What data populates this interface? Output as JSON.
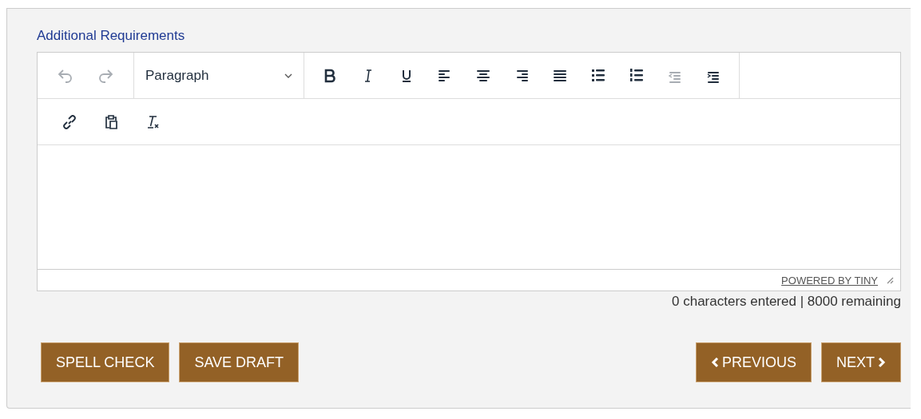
{
  "field": {
    "label": "Additional Requirements"
  },
  "toolbar": [
    {
      "groups": [
        {
          "items": [
            {
              "kind": "undo",
              "disabled": true
            },
            {
              "kind": "redo",
              "disabled": true
            }
          ]
        },
        {
          "items": [
            {
              "kind": "select",
              "value": "Paragraph",
              "disabled": false
            }
          ]
        },
        {
          "items": [
            {
              "kind": "bold",
              "disabled": false
            },
            {
              "kind": "italic",
              "disabled": false
            },
            {
              "kind": "underline",
              "disabled": false
            },
            {
              "kind": "align-left",
              "disabled": false
            },
            {
              "kind": "align-center",
              "disabled": false
            },
            {
              "kind": "align-right",
              "disabled": false
            },
            {
              "kind": "justify",
              "disabled": false
            },
            {
              "kind": "bullets",
              "disabled": false
            },
            {
              "kind": "numbers",
              "disabled": false
            },
            {
              "kind": "outdent",
              "disabled": true
            },
            {
              "kind": "indent",
              "disabled": false
            }
          ]
        }
      ]
    },
    {
      "groups": [
        {
          "items": [
            {
              "kind": "link",
              "disabled": false
            },
            {
              "kind": "paste",
              "disabled": false
            },
            {
              "kind": "clear-format",
              "disabled": false
            }
          ]
        }
      ]
    }
  ],
  "status_bar": {
    "branding": "POWERED BY TINY"
  },
  "counter": "0 characters entered | 8000 remaining",
  "left_buttons": [
    {
      "label": "SPELL CHECK"
    },
    {
      "label": "SAVE DRAFT"
    }
  ],
  "right_buttons": [
    {
      "label": "PREVIOUS",
      "kind": "previous"
    },
    {
      "label": "NEXT",
      "kind": "next"
    }
  ]
}
